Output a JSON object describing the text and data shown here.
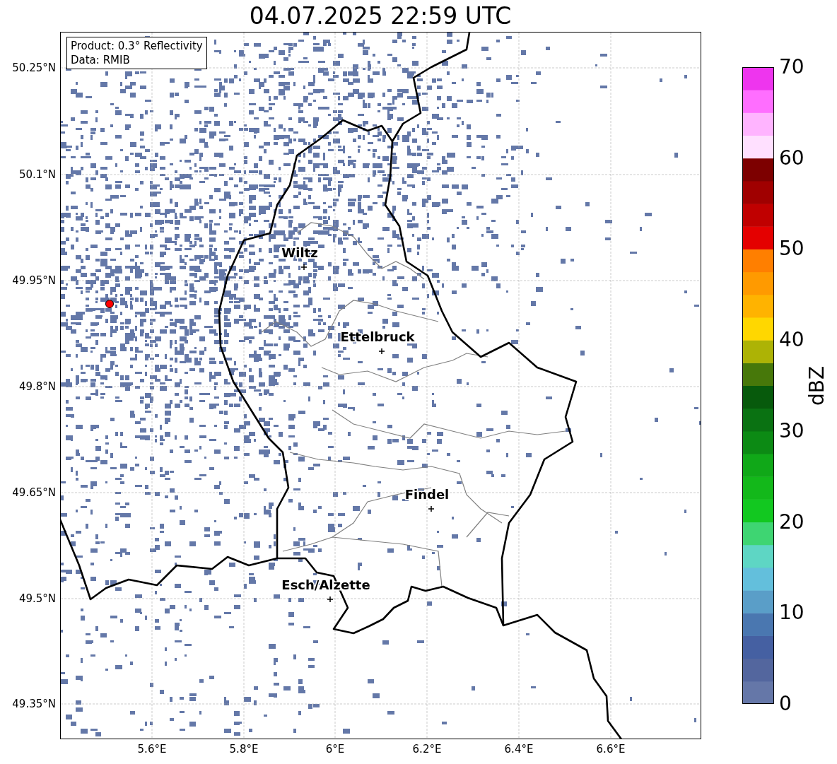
{
  "title": "04.07.2025 22:59 UTC",
  "info": [
    "Product: 0.3° Reflectivity",
    "Data: RMIB"
  ],
  "map": {
    "cities": [
      {
        "name": "Wiltz"
      },
      {
        "name": "Ettelbruck"
      },
      {
        "name": "Findel"
      },
      {
        "name": "Esch/Alzette"
      }
    ],
    "x_ticks": [
      "5.6°E",
      "5.8°E",
      "6°E",
      "6.2°E",
      "6.4°E",
      "6.6°E"
    ],
    "y_ticks": [
      "50.25°N",
      "50.1°N",
      "49.95°N",
      "49.8°N",
      "49.65°N",
      "49.5°N",
      "49.35°N"
    ]
  },
  "colorbar": {
    "label": "dBZ",
    "ticks": [
      "70",
      "60",
      "50",
      "40",
      "30",
      "20",
      "10",
      "0"
    ],
    "segments": [
      {
        "color": "#6577a8"
      },
      {
        "color": "#53669e"
      },
      {
        "color": "#4560a2"
      },
      {
        "color": "#4a77b0"
      },
      {
        "color": "#5a9ec8"
      },
      {
        "color": "#63bfdc"
      },
      {
        "color": "#5ed6c4"
      },
      {
        "color": "#3ed572"
      },
      {
        "color": "#12c820"
      },
      {
        "color": "#13b81a"
      },
      {
        "color": "#10a818"
      },
      {
        "color": "#0c8a14"
      },
      {
        "color": "#0a7212"
      },
      {
        "color": "#075a0c"
      },
      {
        "color": "#47780a"
      },
      {
        "color": "#adb305"
      },
      {
        "color": "#ffd700"
      },
      {
        "color": "#ffb300"
      },
      {
        "color": "#ff9a00"
      },
      {
        "color": "#ff7f00"
      },
      {
        "color": "#e40000"
      },
      {
        "color": "#c00000"
      },
      {
        "color": "#a00000"
      },
      {
        "color": "#7d0000"
      },
      {
        "color": "#ffe0ff"
      },
      {
        "color": "#ffb4ff"
      },
      {
        "color": "#ff6eff"
      },
      {
        "color": "#ee35ee"
      }
    ]
  }
}
